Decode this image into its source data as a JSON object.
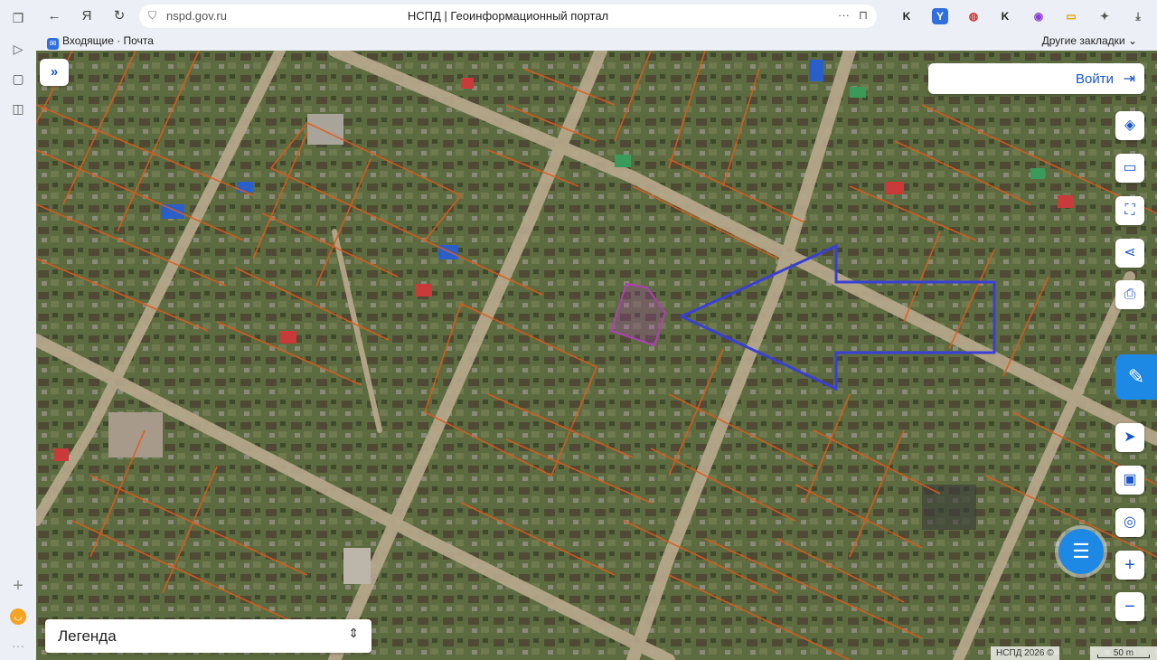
{
  "browser": {
    "url": "nspd.gov.ru",
    "page_title": "НСПД | Геоинформационный портал",
    "more_label": "···",
    "bookmark_label": "Входящие · Почта",
    "other_bookmarks_label": "Другие закладки",
    "other_bookmarks_chevron": "⌄",
    "extensions": [
      "kinopoisk-icon",
      "yandex-icon",
      "shield-ext-icon",
      "kinopoisk-icon",
      "alice-icon",
      "battery-icon",
      "puzzle-icon",
      "download-icon"
    ]
  },
  "map": {
    "login_label": "Войти",
    "legend_label": "Легенда",
    "attribution": "НСПД 2026 ©",
    "scale_label": "50 m",
    "tools": [
      "layers-icon",
      "ruler-icon",
      "select-area-icon",
      "share-icon",
      "print-icon"
    ],
    "nav_tools": [
      "locate-icon",
      "minimap-icon",
      "geolocation-icon",
      "zoom-in-icon",
      "zoom-out-icon"
    ],
    "colors": {
      "parcel_boundary": "#e05a1c",
      "selected_parcel": "#b03fb8",
      "annotation_arrow": "#3a3fd6",
      "ui_accent": "#1a56c8",
      "chat_button": "#1e88e5"
    }
  }
}
